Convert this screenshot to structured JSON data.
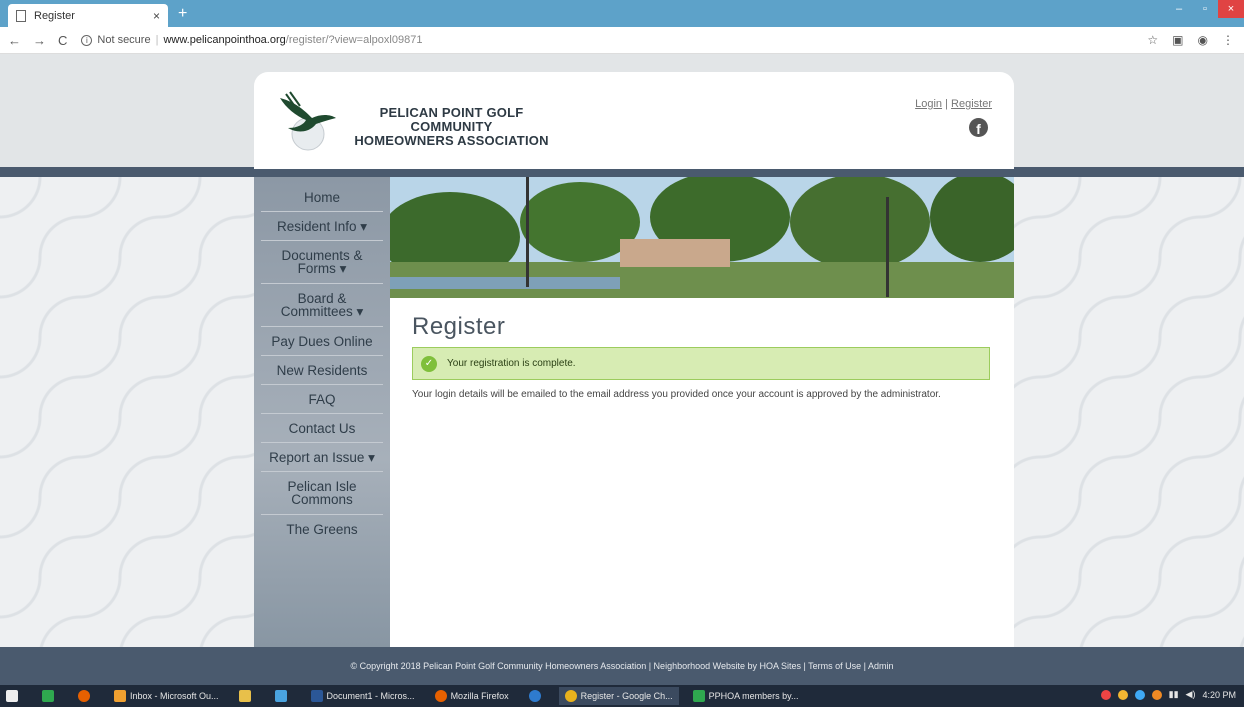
{
  "browser": {
    "tab_title": "Register",
    "tab_close": "×",
    "new_tab": "+",
    "minimize": "–",
    "maximize": "▫",
    "close": "×",
    "back": "←",
    "forward": "→",
    "reload": "C",
    "not_secure": "Not secure",
    "url_host": "www.pelicanpointhoa.org",
    "url_path": "/register/?view=alpoxl09871",
    "star": "☆",
    "menu": "⋮"
  },
  "header": {
    "site_title_line1": "PELICAN POINT GOLF COMMUNITY",
    "site_title_line2": "HOMEOWNERS ASSOCIATION",
    "login": "Login",
    "separator": "|",
    "register": "Register",
    "facebook": "f"
  },
  "sidebar": {
    "items": [
      {
        "label": "Home"
      },
      {
        "label": "Resident Info ▾"
      },
      {
        "label": "Documents & Forms ▾"
      },
      {
        "label": "Board & Committees ▾"
      },
      {
        "label": "Pay Dues Online"
      },
      {
        "label": "New Residents"
      },
      {
        "label": "FAQ"
      },
      {
        "label": "Contact Us"
      },
      {
        "label": "Report an Issue ▾"
      },
      {
        "label": "Pelican Isle Commons"
      },
      {
        "label": "The Greens"
      }
    ]
  },
  "main": {
    "title": "Register",
    "alert": "Your registration is complete.",
    "message": "Your login details will be emailed to the email address you provided once your account is approved by the administrator."
  },
  "footer": {
    "text": "© Copyright 2018 Pelican Point Golf Community Homeowners Association | Neighborhood Website by HOA Sites | Terms of Use | Admin"
  },
  "taskbar": {
    "items": [
      {
        "label": "Inbox - Microsoft Ou..."
      },
      {
        "label": "Document1 - Micros..."
      },
      {
        "label": "Mozilla Firefox"
      },
      {
        "label": "Register - Google Ch..."
      },
      {
        "label": "PPHOA members by..."
      }
    ],
    "time": "4:20 PM"
  },
  "colors": {
    "tabbar": "#5da2c9",
    "stripe": "#4a5a6e",
    "alert_bg": "#d7ecb3",
    "check": "#7fbf3b"
  }
}
